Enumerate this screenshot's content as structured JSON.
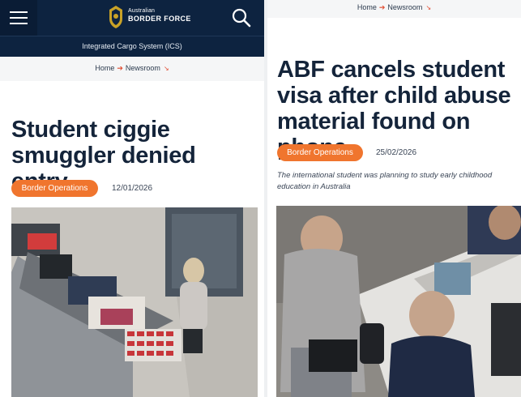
{
  "left": {
    "header": {
      "logo_top": "Australian",
      "logo_main": "BORDER FORCE",
      "menu_icon": "hamburger-menu-icon",
      "search_icon": "search-icon",
      "crest_icon": "crest-logo-icon"
    },
    "subbar": {
      "label": "Integrated Cargo System (ICS)"
    },
    "breadcrumb": {
      "home": "Home",
      "section": "Newsroom"
    },
    "article": {
      "title": "Student ciggie smuggler denied entry",
      "tag": "Border Operations",
      "date": "12/01/2026"
    }
  },
  "right": {
    "breadcrumb": {
      "home": "Home",
      "section": "Newsroom"
    },
    "article": {
      "title": "ABF cancels student visa after child abuse material found on phone",
      "tag": "Border Operations",
      "date": "25/02/2026",
      "standfirst": "The international student was planning to study early childhood education in Australia"
    }
  },
  "colors": {
    "navy": "#0d2340",
    "accent_orange": "#f0752e",
    "breadcrumb_arrow": "#e04a2f"
  }
}
